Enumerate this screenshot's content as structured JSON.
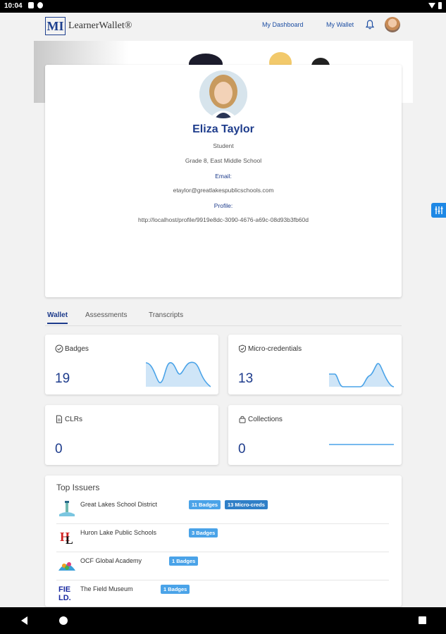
{
  "status_bar": {
    "time": "10:04"
  },
  "header": {
    "logo_mark": "MI",
    "logo_text": "LearnerWallet®",
    "nav": {
      "dashboard": "My Dashboard",
      "wallet": "My Wallet"
    }
  },
  "profile": {
    "name": "Eliza Taylor",
    "role": "Student",
    "school": "Grade 8, East Middle School",
    "email_label": "Email:",
    "email": "etaylor@greatlakespublicschools.com",
    "profile_label": "Profile:",
    "profile_url": "http://localhost/profile/9919e8dc-3090-4676-a69c-08d93b3fb60d"
  },
  "tabs": [
    {
      "label": "Wallet",
      "active": true
    },
    {
      "label": "Assessments",
      "active": false
    },
    {
      "label": "Transcripts",
      "active": false
    }
  ],
  "stats": [
    {
      "label": "Badges",
      "value": "19",
      "icon": "check-circle-icon"
    },
    {
      "label": "Micro-credentials",
      "value": "13",
      "icon": "shield-check-icon"
    },
    {
      "label": "CLRs",
      "value": "0",
      "icon": "document-icon"
    },
    {
      "label": "Collections",
      "value": "0",
      "icon": "lock-icon"
    }
  ],
  "colors": {
    "accent": "#1e3c8c",
    "spark_line": "#4aa3e8",
    "spark_fill": "#cfe5f7",
    "pill": "#4aa3e8"
  },
  "top_issuers": {
    "title": "Top Issuers",
    "items": [
      {
        "name": "Great Lakes School District",
        "badges": "11 Badges",
        "micro": "13 Micro-creds",
        "logo": "lighthouse-icon"
      },
      {
        "name": "Huron Lake Public Schools",
        "badges": "3 Badges",
        "logo": "hl-logo-icon"
      },
      {
        "name": "OCF Global Academy",
        "badges": "1 Badges",
        "logo": "globe-logo-icon"
      },
      {
        "name": "The Field Museum",
        "badges": "1 Badges",
        "logo": "field-logo-icon"
      }
    ]
  }
}
